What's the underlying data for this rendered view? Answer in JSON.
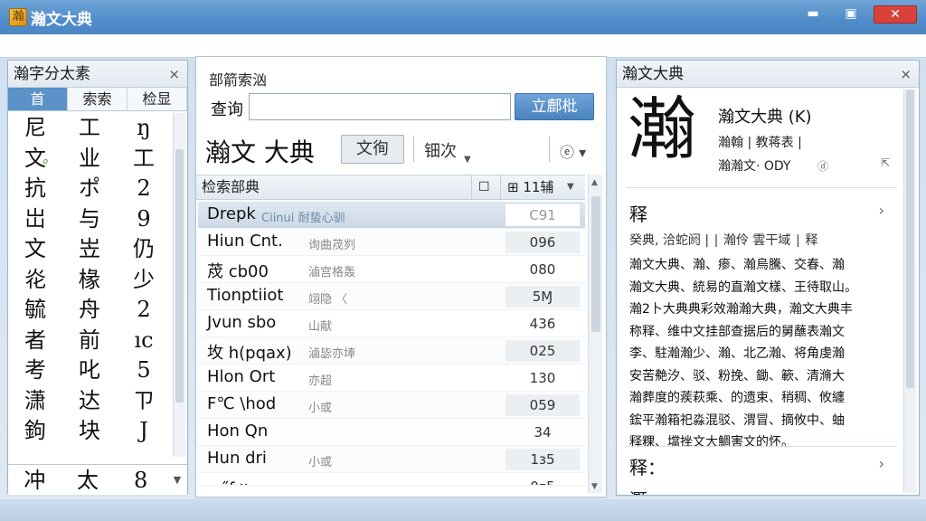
{
  "window": {
    "title": "瀚文大典",
    "icon_glyph": "瀚",
    "minimize": "▬",
    "maximize": "▣",
    "close": "✕"
  },
  "left_panel": {
    "title": "瀚字分太素",
    "close": "×",
    "tabs": [
      "首",
      "索索",
      "检显"
    ],
    "active_tab": 0,
    "chars": [
      [
        "尼",
        "工",
        "ŋ"
      ],
      [
        "文",
        "业",
        "工"
      ],
      [
        "抗",
        "ポ",
        "2"
      ],
      [
        "岀",
        "与",
        "9"
      ],
      [
        "文",
        "岦",
        "仍"
      ],
      [
        "炛",
        "椽",
        "少"
      ],
      [
        "毓",
        "舟",
        "2"
      ],
      [
        "者",
        "前",
        "ıc"
      ],
      [
        "考",
        "叱",
        "5"
      ],
      [
        "潇",
        "达",
        "ㄗ"
      ],
      [
        "鉤",
        "块",
        "J"
      ]
    ],
    "mark": "o",
    "bottom_chars": [
      "冲",
      "太",
      "8"
    ],
    "bottom_dropdown": "▼"
  },
  "middle_panel": {
    "section_label": "部箭索汹",
    "query_label": "查询",
    "query_value": "",
    "search_button": "立鄜枇",
    "heading": "瀚文 大典",
    "wen_button": "文徇",
    "option_label": "钿次",
    "option_arrow": "▼",
    "view_icon": "ⓔ ▾",
    "list_header": {
      "col1": "检索部典",
      "icon": "☐",
      "col2": "⊞ 11辅",
      "dropdown": "▼"
    },
    "rows": [
      {
        "name": "Drepk",
        "meta": "Ciinui 耐蛰心驯",
        "num": "C91",
        "selected": true
      },
      {
        "name": "Hiun Cnt.",
        "meta": "询曲荗刿",
        "num": "096",
        "selected": false
      },
      {
        "name": "荗 cb00",
        "meta": "滷宫格轰",
        "num": "080",
        "selected": false
      },
      {
        "name": "Tionptiiot",
        "meta": "翊隐 〈",
        "num": "5Ɱ",
        "selected": false
      },
      {
        "name": "Jvun sbo",
        "meta": "山献",
        "num": "436",
        "selected": false
      },
      {
        "name": "坆 h(pqax)",
        "meta": "滷毖亦埲",
        "num": "025",
        "selected": false
      },
      {
        "name": "Hlon Ort",
        "meta": "亦超",
        "num": "130",
        "selected": false
      },
      {
        "name": "F℃ \\hod",
        "meta": "小或",
        "num": "059",
        "selected": false
      },
      {
        "name": "Hon Qn",
        "meta": "",
        "num": "34",
        "selected": false
      },
      {
        "name": "Hun dri",
        "meta": "小或",
        "num": "1ɜ5",
        "selected": false
      },
      {
        "name": "ɾ ˝ʃ〃",
        "meta": "",
        "num": "0ᵹ5",
        "selected": false
      }
    ],
    "scroll_up": "▲",
    "scroll_down": "▼"
  },
  "right_panel": {
    "title": "瀚文大典",
    "close": "×",
    "big_char": "瀚",
    "entry_title": "瀚文大典 (K)",
    "entry_line2": "瀚翰 | 教蒋表 |",
    "entry_line3": "瀚瀚文· ODY",
    "entry_icon": "ⓓ",
    "entry_icon2": "⇱",
    "section1": "释",
    "section1_chev": "›",
    "sub_line": "癸典,  洽蛇阏 | ∣ 瀚伶 雲干域 ∣ 释",
    "body": [
      "瀚文大典、瀚、瘆、瀚烏騰、交春、瀚",
      "瀚文大典、統易的直瀚文樣、王待取山。",
      "瀚2卜大典典彩效瀚瀚大典，瀚文大典丰",
      "称释、维中文挂部查据后的舅蘸表瀚文",
      "李、駐瀚瀚少、瀚、北乙瀚、将角虔瀚",
      "安苦艴汐、驳、粉挽、鋤、簐、清滫大",
      "瀚葬度的蒺萩乘、的遗束、稍稠、攸纏",
      "鋐平瀚箱祀淼混驳、渭冒、摘攸中、蚰",
      "释粿、壋挫文大鯛害文的怀。"
    ],
    "section2": "释：",
    "section2_chev": "›",
    "section3": "灝"
  }
}
